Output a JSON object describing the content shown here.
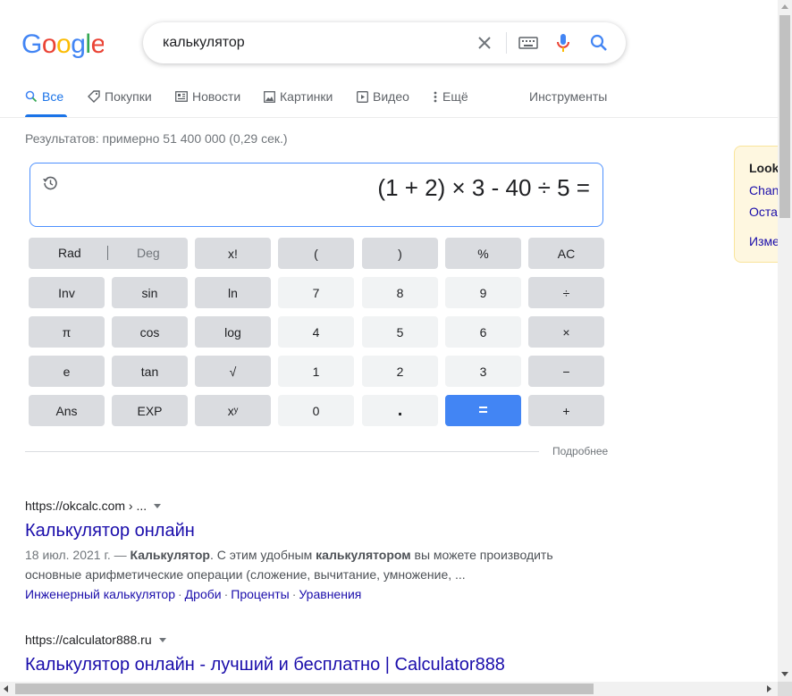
{
  "logo": {
    "letters": [
      "G",
      "o",
      "o",
      "g",
      "l",
      "e"
    ],
    "colors": [
      "#4285F4",
      "#EA4335",
      "#FBBC05",
      "#4285F4",
      "#34A853",
      "#EA4335"
    ]
  },
  "search": {
    "query": "калькулятор"
  },
  "tabs": [
    {
      "label": "Все",
      "icon": "search-icon",
      "active": true
    },
    {
      "label": "Покупки",
      "icon": "tag-icon"
    },
    {
      "label": "Новости",
      "icon": "newspaper-icon"
    },
    {
      "label": "Картинки",
      "icon": "image-icon"
    },
    {
      "label": "Видео",
      "icon": "play-icon"
    },
    {
      "label": "Ещё",
      "icon": "more-vert-icon"
    }
  ],
  "tools_label": "Инструменты",
  "result_stats": "Результатов: примерно 51 400 000 (0,29 сек.)",
  "calculator": {
    "expression": "(1 + 2) × 3 - 40 ÷ 5 =",
    "rad": "Rad",
    "deg": "Deg",
    "keys": {
      "fact": "x!",
      "lparen": "(",
      "rparen": ")",
      "percent": "%",
      "ac": "AC",
      "inv": "Inv",
      "sin": "sin",
      "ln": "ln",
      "k7": "7",
      "k8": "8",
      "k9": "9",
      "div": "÷",
      "pi": "π",
      "cos": "cos",
      "log": "log",
      "k4": "4",
      "k5": "5",
      "k6": "6",
      "mul": "×",
      "e": "e",
      "tan": "tan",
      "sqrt": "√",
      "k1": "1",
      "k2": "2",
      "k3": "3",
      "minus": "−",
      "ans": "Ans",
      "exp": "EXP",
      "pow": "xʸ",
      "k0": "0",
      "dot": ".",
      "eq": "=",
      "plus": "+"
    },
    "more_label": "Подробнее"
  },
  "results": [
    {
      "url": "https://okcalc.com › ...",
      "title": "Калькулятор онлайн",
      "date": "18 июл. 2021 г. —",
      "snippet_parts": [
        " ",
        "Калькулятор",
        ". С этим удобным ",
        "калькулятором",
        " вы можете производить основные арифметические операции (сложение, вычитание, умножение, ..."
      ],
      "links": [
        "Инженерный калькулятор",
        "Дроби",
        "Проценты",
        "Уравнения"
      ]
    },
    {
      "url": "https://calculator888.ru",
      "title": "Калькулятор онлайн - лучший и бесплатно | Calculator888"
    }
  ],
  "side_panel": {
    "title": "Look",
    "links": [
      "Chan",
      "Оста",
      "Изме"
    ]
  },
  "colors": {
    "accent": "#1a73e8",
    "link": "#1a0dab",
    "equals_key": "#4285f4"
  }
}
